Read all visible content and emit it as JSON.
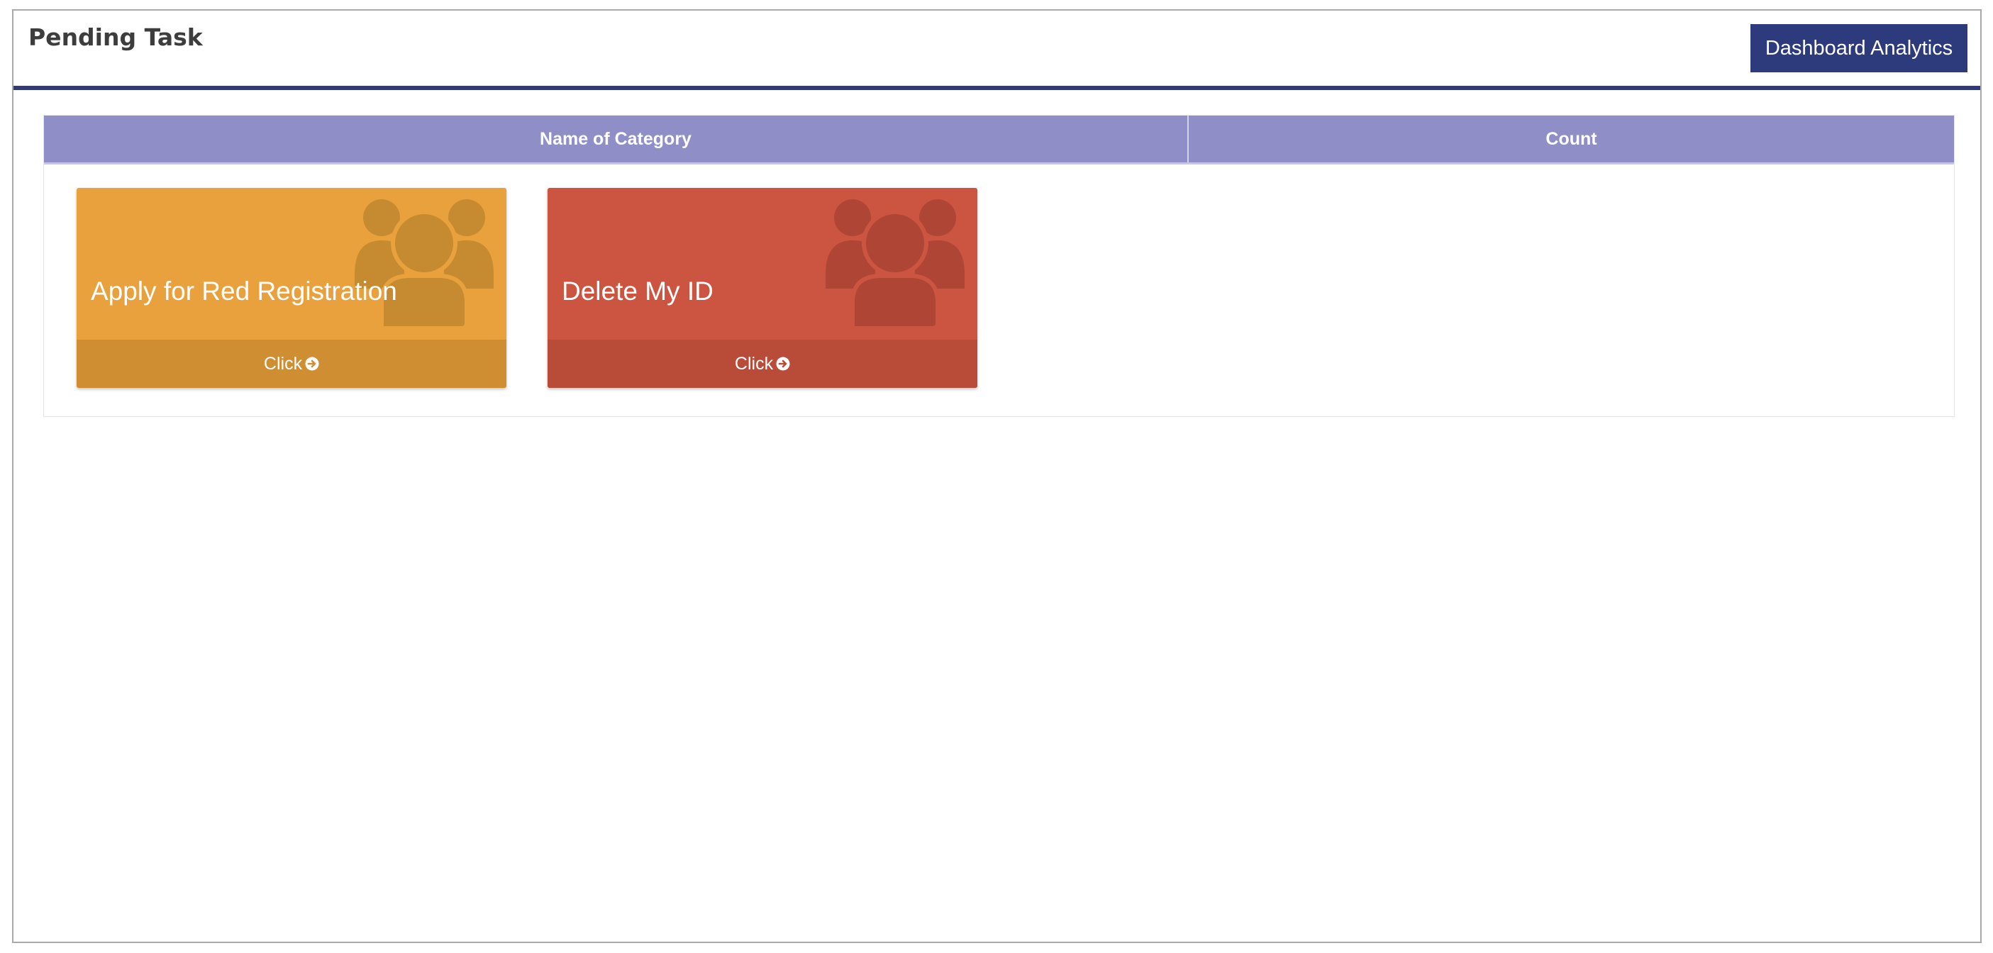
{
  "header": {
    "title": "Pending Task",
    "analytics_button": "Dashboard Analytics"
  },
  "table": {
    "columns": [
      "Name of Category",
      "Count"
    ]
  },
  "cards": [
    {
      "title": "Apply for Red Registration",
      "action": "Click",
      "icon": "users-icon",
      "color": "#e8a13c"
    },
    {
      "title": "Delete My ID",
      "action": "Click",
      "icon": "users-icon",
      "color": "#cc5541"
    }
  ],
  "colors": {
    "accent": "#2d3a7c",
    "table_header": "#8f8ec7"
  }
}
